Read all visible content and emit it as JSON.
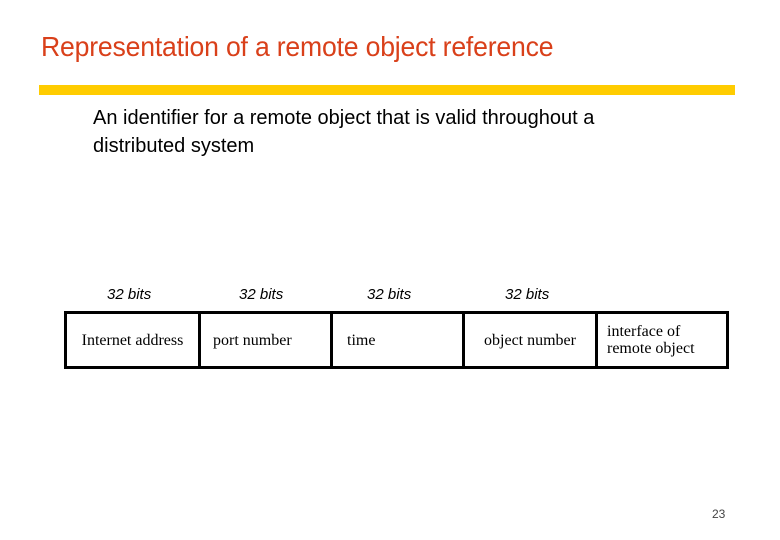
{
  "slide": {
    "title": "Representation of a remote object reference",
    "subtitle": "An identifier for a remote object that is valid throughout a distributed system",
    "page_number": "23",
    "colors": {
      "title": "#d9401a",
      "rule": "#ffcc00"
    }
  },
  "diagram": {
    "bit_labels": [
      "32 bits",
      "32 bits",
      "32 bits",
      "32 bits"
    ],
    "fields": [
      "Internet address",
      "port number",
      "time",
      "object number",
      "interface of remote object"
    ]
  }
}
